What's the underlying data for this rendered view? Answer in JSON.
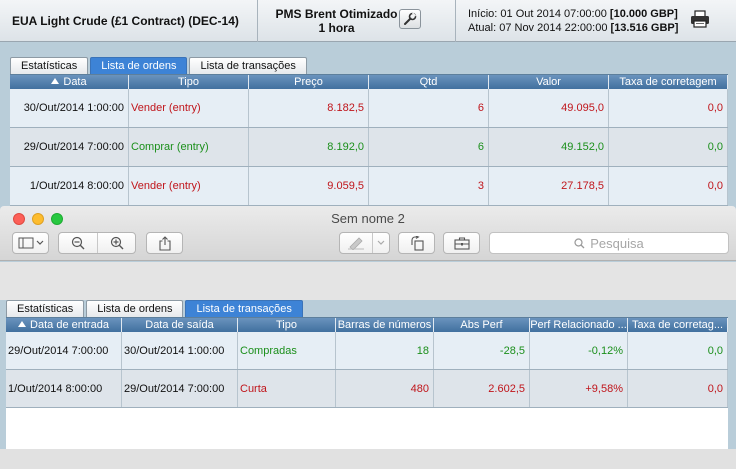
{
  "report": {
    "instrument": "EUA Light Crude (£1 Contract) (DEC-14)",
    "strategy_line1": "PMS Brent Otimizado",
    "strategy_line2": "1 hora",
    "start_label": "Início:",
    "start_date": "01 Out 2014 07:00:00",
    "start_value": "[10.000 GBP]",
    "end_label": "Atual:",
    "end_date": "07 Nov 2014 22:00:00",
    "end_value": "[13.516 GBP]"
  },
  "top_tabs": [
    "Estatísticas",
    "Lista de ordens",
    "Lista de transações"
  ],
  "top_active_tab": 1,
  "orders": {
    "columns": [
      "Data",
      "Tipo",
      "Preço",
      "Qtd",
      "Valor",
      "Taxa de corretagem"
    ],
    "rows": [
      {
        "date": "30/Out/2014 1:00:00",
        "type": "Vender (entry)",
        "price": "8.182,5",
        "qty": "6",
        "value": "49.095,0",
        "fee": "0,0",
        "color": "red"
      },
      {
        "date": "29/Out/2014 7:00:00",
        "type": "Comprar (entry)",
        "price": "8.192,0",
        "qty": "6",
        "value": "49.152,0",
        "fee": "0,0",
        "color": "green"
      },
      {
        "date": "1/Out/2014 8:00:00",
        "type": "Vender (entry)",
        "price": "9.059,5",
        "qty": "3",
        "value": "27.178,5",
        "fee": "0,0",
        "color": "red"
      }
    ]
  },
  "window": {
    "title": "Sem nome 2",
    "search_placeholder": "Pesquisa"
  },
  "bottom_tabs": [
    "Estatísticas",
    "Lista de ordens",
    "Lista de transações"
  ],
  "bottom_active_tab": 2,
  "transactions": {
    "columns": [
      "Data de entrada",
      "Data de saída",
      "Tipo",
      "Barras de números",
      "Abs Perf",
      "Perf Relacionado ...",
      "Taxa de corretag..."
    ],
    "rows": [
      {
        "entry": "29/Out/2014 7:00:00",
        "exit": "30/Out/2014 1:00:00",
        "type": "Compradas",
        "bars": "18",
        "abs": "-28,5",
        "rel": "-0,12%",
        "fee": "0,0",
        "color": "green"
      },
      {
        "entry": "1/Out/2014 8:00:00",
        "exit": "29/Out/2014 7:00:00",
        "type": "Curta",
        "bars": "480",
        "abs": "2.602,5",
        "rel": "+9,58%",
        "fee": "0,0",
        "color": "red"
      }
    ]
  },
  "colors": {
    "accent": "#3d83d6",
    "header_blue": "#41709f",
    "sell_red": "#c0151b",
    "buy_green": "#1b8f1b",
    "panel_bg": "#b9cdd9"
  },
  "icons": [
    "wrench-icon",
    "printer-icon",
    "sidebar-icon",
    "zoom-out-icon",
    "zoom-in-icon",
    "share-icon",
    "markup-pen-icon",
    "rotate-icon",
    "toolbox-icon",
    "search-icon",
    "sort-up-icon"
  ]
}
